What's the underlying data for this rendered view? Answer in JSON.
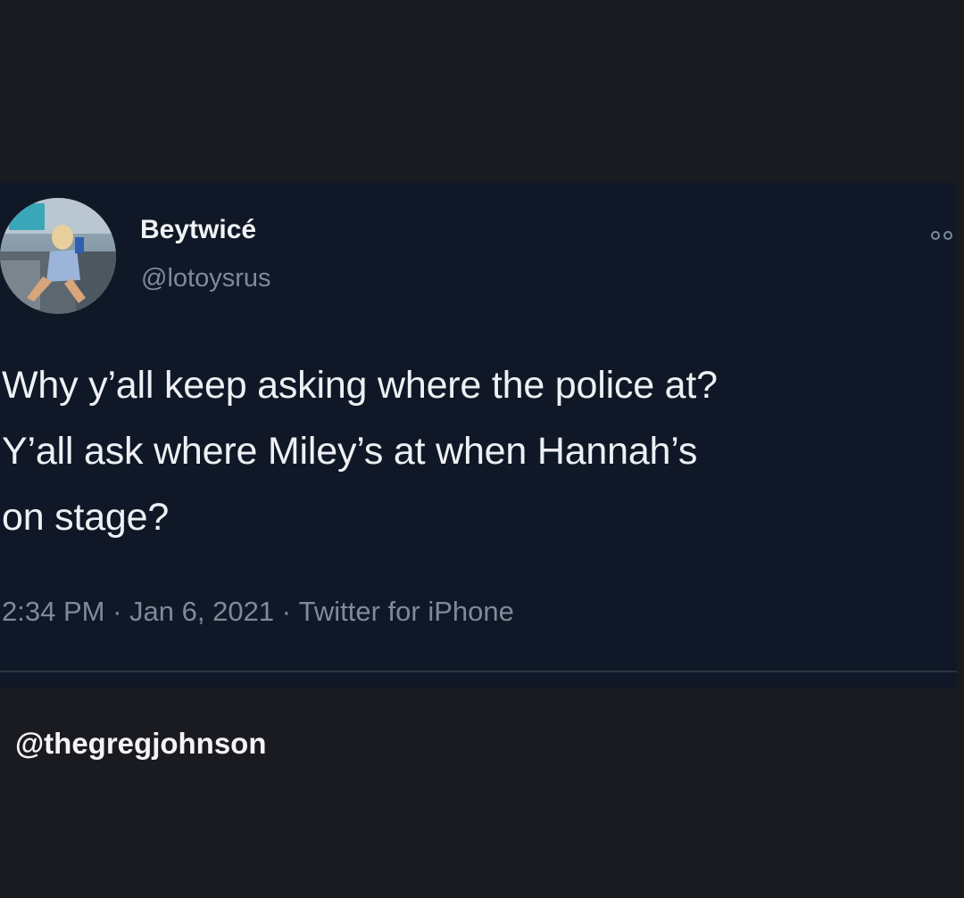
{
  "tweet": {
    "author": {
      "display_name": "Beytwicé",
      "handle": "@lotoysrus"
    },
    "text_lines": [
      "Why y’all keep asking where the police at?",
      "Y’all ask where Miley’s at when Hannah’s",
      "on stage?"
    ],
    "meta": {
      "time": "2:34 PM",
      "separator": "·",
      "date": "Jan 6, 2021",
      "source": "Twitter for iPhone"
    },
    "more_icon": "more-options-icon"
  },
  "watermark": "@thegregjohnson",
  "colors": {
    "page_bg": "#191b20",
    "card_bg": "#101827",
    "text_primary": "#eef0f3",
    "text_secondary": "#7f8a99"
  }
}
